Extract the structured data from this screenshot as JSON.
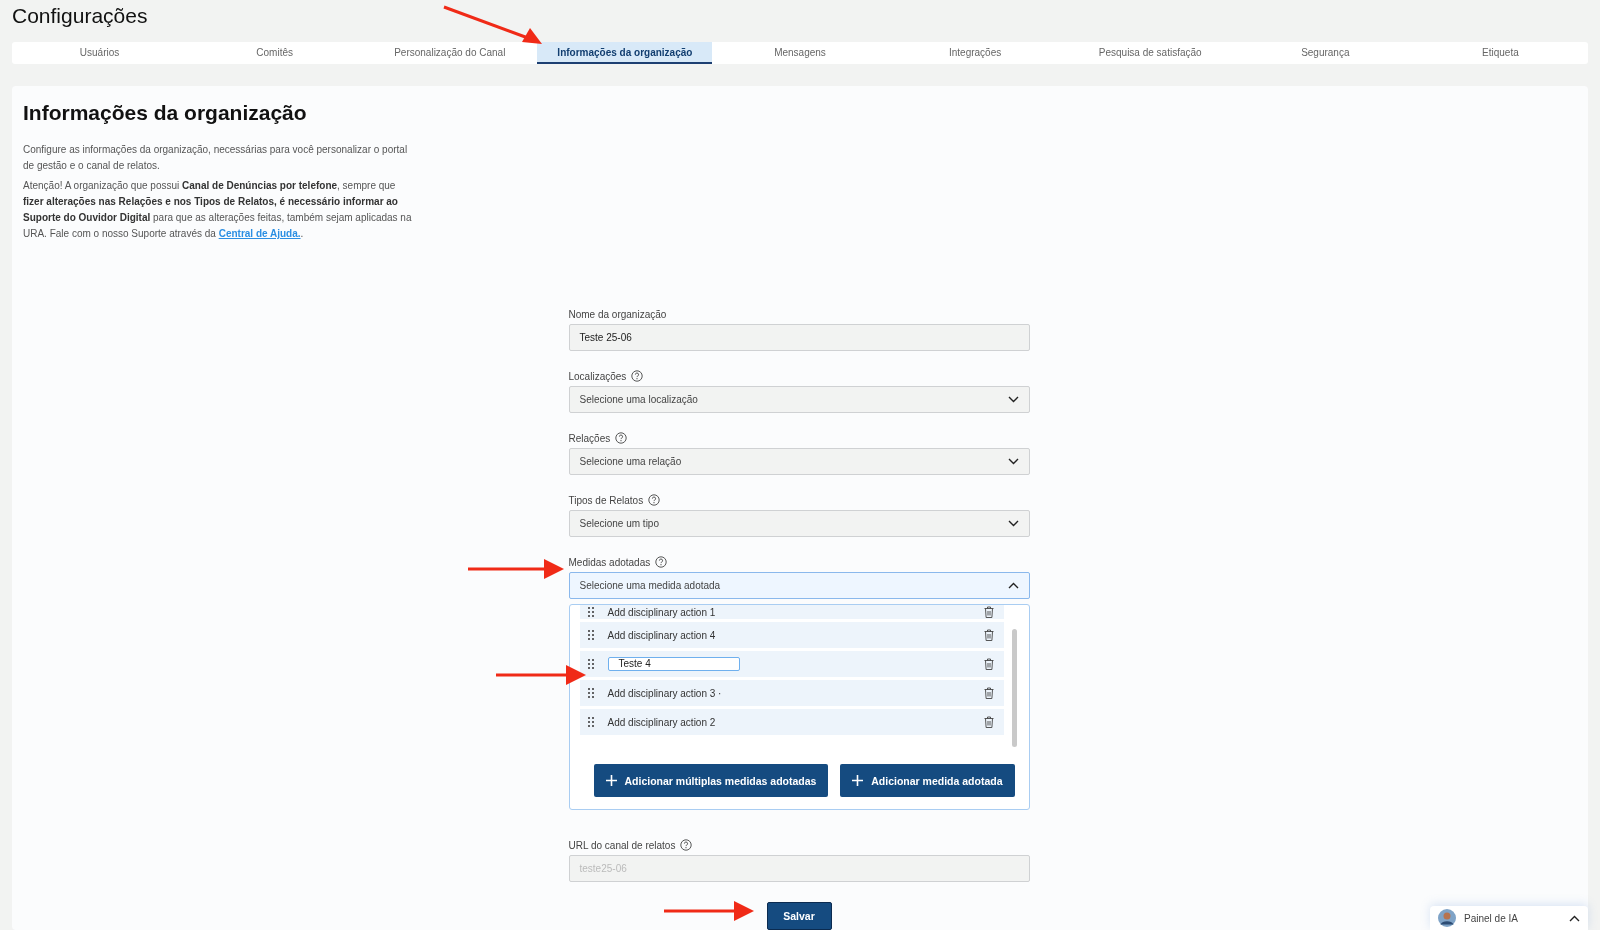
{
  "page_title": "Configurações",
  "tabs": [
    {
      "label": "Usuários",
      "selected": false
    },
    {
      "label": "Comitês",
      "selected": false
    },
    {
      "label": "Personalização do Canal",
      "selected": false
    },
    {
      "label": "Informações da organização",
      "selected": true
    },
    {
      "label": "Mensagens",
      "selected": false
    },
    {
      "label": "Integrações",
      "selected": false
    },
    {
      "label": "Pesquisa de satisfação",
      "selected": false
    },
    {
      "label": "Segurança",
      "selected": false
    },
    {
      "label": "Etiqueta",
      "selected": false
    }
  ],
  "section": {
    "title": "Informações da organização",
    "intro": "Configure as informações da organização, necessárias para você personalizar o portal de gestão e o canal de relatos.",
    "warning": "Atenção! A organização que possui **Canal de Denúncias por telefone**, sempre que **fizer alterações nas Relações e nos Tipos de Relatos, é necessário informar ao Suporte do Ouvidor Digital** para que as alterações feitas, também sejam aplicadas na URA. Fale com o nosso Suporte através da",
    "link": "Central de Ajuda.",
    "after_link": "."
  },
  "fields": [
    {
      "kind": "text",
      "label": "Nome da organização",
      "value": "Teste 25-06"
    },
    {
      "kind": "select",
      "label": "Localizações",
      "help": true,
      "placeholder": "Selecione uma localização",
      "expanded": false
    },
    {
      "kind": "select",
      "label": "Relações",
      "help": true,
      "placeholder": "Selecione uma relação",
      "expanded": false
    },
    {
      "kind": "select",
      "label": "Tipos de Relatos",
      "help": true,
      "placeholder": "Selecione um tipo",
      "expanded": false
    },
    {
      "kind": "select",
      "label": "Medidas adotadas",
      "help": true,
      "placeholder": "Selecione uma medida adotada",
      "expanded": true,
      "items": [
        {
          "kind": "text",
          "label": "Add disciplinary action 1"
        },
        {
          "kind": "text",
          "label": "Add disciplinary action 4"
        },
        {
          "kind": "editing",
          "label": "Teste 4"
        },
        {
          "kind": "text",
          "label": "Add disciplinary action 3 ·"
        },
        {
          "kind": "text",
          "label": "Add disciplinary action 2"
        }
      ],
      "buttons": [
        "Adicionar múltiplas medidas adotadas",
        "Adicionar medida adotada"
      ]
    },
    {
      "kind": "readonly",
      "label": "URL do canal de relatos",
      "help": true,
      "placeholder": "teste25-06"
    }
  ],
  "save_button": "Salvar",
  "ai_panel": {
    "label": "Painel de IA",
    "expanded": false
  }
}
